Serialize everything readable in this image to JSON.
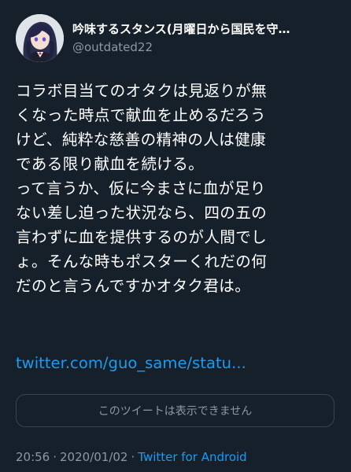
{
  "author": {
    "display_name": "吟味するスタンス(月曜日から国民を守…",
    "handle": "@outdated22",
    "avatar_icon": "anime-character-avatar"
  },
  "tweet": {
    "lines": [
      "コラボ目当てのオタクは見返りが無",
      "くなった時点で献血を止めるだろう",
      "けど、純粋な慈善の精神の人は健康",
      "である限り献血を続ける。",
      "って言うか、仮に今まさに血が足り",
      "ない差し迫った状況なら、四の五の",
      "言わずに血を提供するのが人間でし",
      "ょ。そんな時もポスターくれだの何",
      "だのと言うんですかオタク君は。"
    ],
    "link": "twitter.com/guo_same/statu..."
  },
  "quoted_tweet": {
    "unavailable_text": "このツイートは表示できません"
  },
  "meta": {
    "time": "20:56",
    "separator": "·",
    "date": "2020/01/02",
    "source": "Twitter for Android"
  },
  "colors": {
    "background": "#15202b",
    "text": "#ffffff",
    "secondary": "#8b98a5",
    "link": "#1d9bf0",
    "border": "#38444d"
  }
}
